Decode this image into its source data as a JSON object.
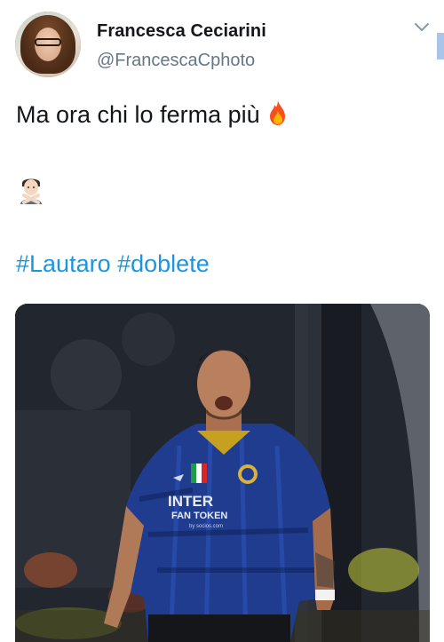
{
  "author": {
    "display_name": "Francesca Ceciarini",
    "handle": "@FrancescaCphoto"
  },
  "tweet": {
    "line1": "Ma ora chi lo ferma più",
    "emoji_1": "fire-icon",
    "emoji_2": "person-gesturing-no-icon",
    "hashtags": [
      "#Lautaro",
      "#doblete"
    ]
  },
  "media": {
    "jersey_sponsor": "INTER",
    "jersey_sponsor_sub": "FAN TOKEN",
    "jersey_sponsor_small": "by socios.com"
  },
  "colors": {
    "hashtag": "#1b95e0",
    "handle": "#657786",
    "text": "#14171a",
    "jersey": "#1f3c8f"
  }
}
